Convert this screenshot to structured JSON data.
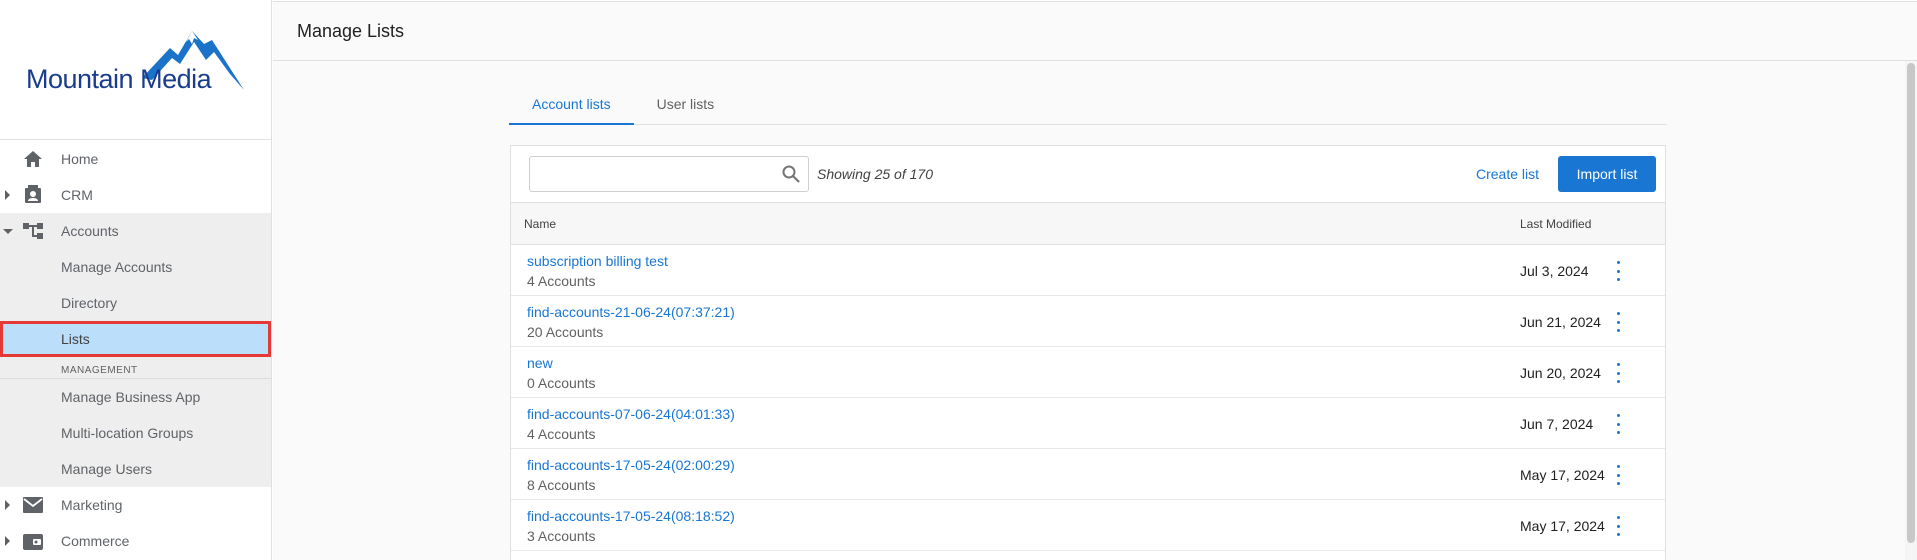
{
  "brand": {
    "name": "Mountain Media"
  },
  "sidebar": {
    "items": [
      {
        "label": "Home",
        "icon": "home-icon"
      },
      {
        "label": "CRM",
        "icon": "contact-card-icon"
      },
      {
        "label": "Accounts",
        "icon": "hierarchy-icon"
      }
    ],
    "accounts_sub": [
      "Manage Accounts",
      "Directory",
      "Lists"
    ],
    "section_label": "MANAGEMENT",
    "management_sub": [
      "Manage Business App",
      "Multi-location Groups",
      "Manage Users"
    ],
    "bottom_items": [
      {
        "label": "Marketing",
        "icon": "mail-icon"
      },
      {
        "label": "Commerce",
        "icon": "wallet-icon"
      }
    ]
  },
  "header": {
    "title": "Manage Lists"
  },
  "tabs": [
    {
      "label": "Account lists",
      "active": true
    },
    {
      "label": "User lists",
      "active": false
    }
  ],
  "toolbar": {
    "search_placeholder": "",
    "showing": "Showing 25 of 170",
    "create_label": "Create list",
    "import_label": "Import list"
  },
  "table": {
    "columns": [
      "Name",
      "Last Modified"
    ],
    "rows": [
      {
        "name": "subscription billing test",
        "count": "4 Accounts",
        "modified": "Jul 3, 2024"
      },
      {
        "name": "find-accounts-21-06-24(07:37:21)",
        "count": "20 Accounts",
        "modified": "Jun 21, 2024"
      },
      {
        "name": "new",
        "count": "0 Accounts",
        "modified": "Jun 20, 2024"
      },
      {
        "name": "find-accounts-07-06-24(04:01:33)",
        "count": "4 Accounts",
        "modified": "Jun 7, 2024"
      },
      {
        "name": "find-accounts-17-05-24(02:00:29)",
        "count": "8 Accounts",
        "modified": "May 17, 2024"
      },
      {
        "name": "find-accounts-17-05-24(08:18:52)",
        "count": "3 Accounts",
        "modified": "May 17, 2024"
      }
    ]
  },
  "colors": {
    "accent": "#1976d2",
    "brand": "#1a3c8c",
    "active_bg": "#bbdefb",
    "highlight": "#e53935"
  }
}
